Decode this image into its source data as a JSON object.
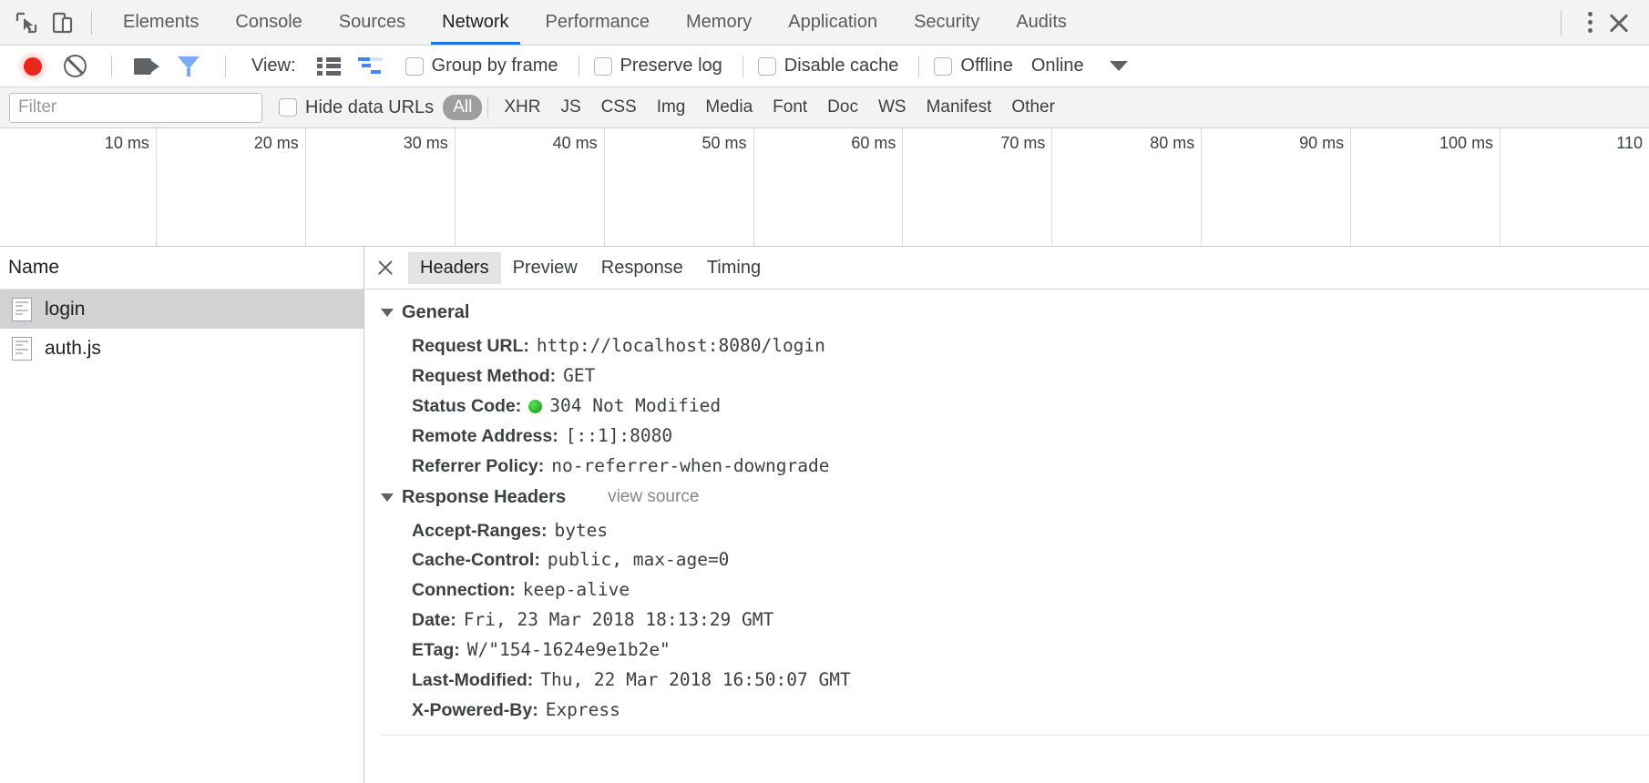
{
  "tabbar": {
    "inspect_icon": "cursor-select-icon",
    "device_icon": "device-toolbar-icon",
    "tabs": [
      {
        "label": "Elements",
        "active": false
      },
      {
        "label": "Console",
        "active": false
      },
      {
        "label": "Sources",
        "active": false
      },
      {
        "label": "Network",
        "active": true
      },
      {
        "label": "Performance",
        "active": false
      },
      {
        "label": "Memory",
        "active": false
      },
      {
        "label": "Application",
        "active": false
      },
      {
        "label": "Security",
        "active": false
      },
      {
        "label": "Audits",
        "active": false
      }
    ],
    "menu_icon": "kebab-menu-icon",
    "close_icon": "close-icon"
  },
  "toolbar": {
    "record_icon": "record-button-icon",
    "clear_icon": "clear-icon",
    "capture_screenshots_icon": "camera-icon",
    "filter_icon": "funnel-filter-icon",
    "view_label": "View:",
    "view_list_icon": "list-view-icon",
    "view_waterfall_icon": "waterfall-view-icon",
    "group_by_frame": {
      "label": "Group by frame",
      "checked": false
    },
    "preserve_log": {
      "label": "Preserve log",
      "checked": false
    },
    "disable_cache": {
      "label": "Disable cache",
      "checked": false
    },
    "offline": {
      "label": "Offline",
      "checked": false
    },
    "throttling": "Online",
    "throttling_caret_icon": "chevron-down-icon"
  },
  "filterbar": {
    "filter_placeholder": "Filter",
    "filter_value": "",
    "hide_data_urls": {
      "label": "Hide data URLs",
      "checked": false
    },
    "types": [
      {
        "label": "All",
        "active": true
      },
      {
        "label": "XHR",
        "active": false
      },
      {
        "label": "JS",
        "active": false
      },
      {
        "label": "CSS",
        "active": false
      },
      {
        "label": "Img",
        "active": false
      },
      {
        "label": "Media",
        "active": false
      },
      {
        "label": "Font",
        "active": false
      },
      {
        "label": "Doc",
        "active": false
      },
      {
        "label": "WS",
        "active": false
      },
      {
        "label": "Manifest",
        "active": false
      },
      {
        "label": "Other",
        "active": false
      }
    ]
  },
  "overview": {
    "ticks": [
      "10 ms",
      "20 ms",
      "30 ms",
      "40 ms",
      "50 ms",
      "60 ms",
      "70 ms",
      "80 ms",
      "90 ms",
      "100 ms",
      "110"
    ]
  },
  "requests": {
    "column_header": "Name",
    "rows": [
      {
        "name": "login",
        "icon": "document-icon",
        "selected": true
      },
      {
        "name": "auth.js",
        "icon": "document-icon",
        "selected": false
      }
    ]
  },
  "details": {
    "close_icon": "close-icon",
    "tabs": [
      {
        "label": "Headers",
        "active": true
      },
      {
        "label": "Preview",
        "active": false
      },
      {
        "label": "Response",
        "active": false
      },
      {
        "label": "Timing",
        "active": false
      }
    ],
    "general": {
      "title": "General",
      "expanded": true,
      "rows": [
        {
          "key": "Request URL:",
          "value": "http://localhost:8080/login"
        },
        {
          "key": "Request Method:",
          "value": "GET"
        },
        {
          "key": "Status Code:",
          "value": "304 Not Modified",
          "status_dot": "green"
        },
        {
          "key": "Remote Address:",
          "value": "[::1]:8080"
        },
        {
          "key": "Referrer Policy:",
          "value": "no-referrer-when-downgrade"
        }
      ]
    },
    "response_headers": {
      "title": "Response Headers",
      "view_source": "view source",
      "expanded": true,
      "rows": [
        {
          "key": "Accept-Ranges:",
          "value": "bytes"
        },
        {
          "key": "Cache-Control:",
          "value": "public, max-age=0"
        },
        {
          "key": "Connection:",
          "value": "keep-alive"
        },
        {
          "key": "Date:",
          "value": "Fri, 23 Mar 2018 18:13:29 GMT"
        },
        {
          "key": "ETag:",
          "value": "W/\"154-1624e9e1b2e\""
        },
        {
          "key": "Last-Modified:",
          "value": "Thu, 22 Mar 2018 16:50:07 GMT"
        },
        {
          "key": "X-Powered-By:",
          "value": "Express"
        }
      ]
    }
  },
  "colors": {
    "accent": "#1a73e8",
    "record": "#e8281e",
    "status_ok": "#2ab02a",
    "selected_row": "#d2d2d2"
  }
}
